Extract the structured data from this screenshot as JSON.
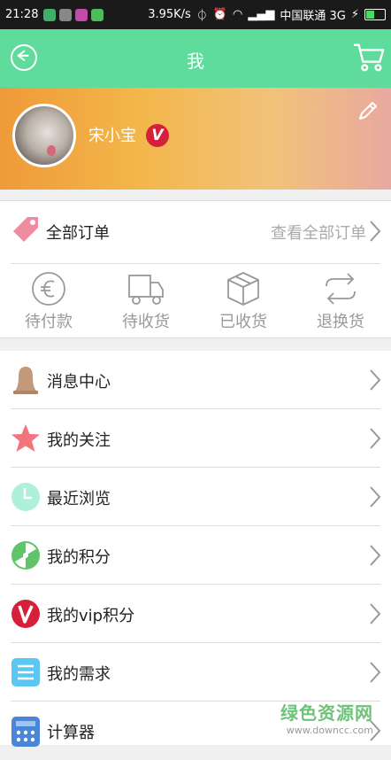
{
  "status_bar": {
    "time": "21:28",
    "speed": "3.95K/s",
    "carrier": "中国联通 3G"
  },
  "header": {
    "title": "我",
    "back_icon": "back-circle-icon",
    "cart_icon": "cart-icon"
  },
  "profile": {
    "username": "宋小宝",
    "vip_badge": "V",
    "edit_icon": "pencil-icon"
  },
  "orders": {
    "label": "全部订单",
    "view_all": "查看全部订单",
    "items": [
      {
        "label": "待付款",
        "icon": "euro-coin-icon"
      },
      {
        "label": "待收货",
        "icon": "truck-icon"
      },
      {
        "label": "已收货",
        "icon": "package-icon"
      },
      {
        "label": "退换货",
        "icon": "exchange-arrows-icon"
      }
    ]
  },
  "menu": {
    "items": [
      {
        "label": "消息中心",
        "icon": "bell-icon"
      },
      {
        "label": "我的关注",
        "icon": "star-icon"
      },
      {
        "label": "最近浏览",
        "icon": "clock-icon"
      },
      {
        "label": "我的积分",
        "icon": "radiation-icon"
      },
      {
        "label": "我的vip积分",
        "icon": "vip-icon"
      },
      {
        "label": "我的需求",
        "icon": "list-icon"
      },
      {
        "label": "计算器",
        "icon": "calculator-icon"
      }
    ]
  },
  "watermark": {
    "title": "绿色资源网",
    "url": "www.downcc.com"
  },
  "colors": {
    "header_bg": "#5fdc9c",
    "vip_red": "#d6203a"
  }
}
